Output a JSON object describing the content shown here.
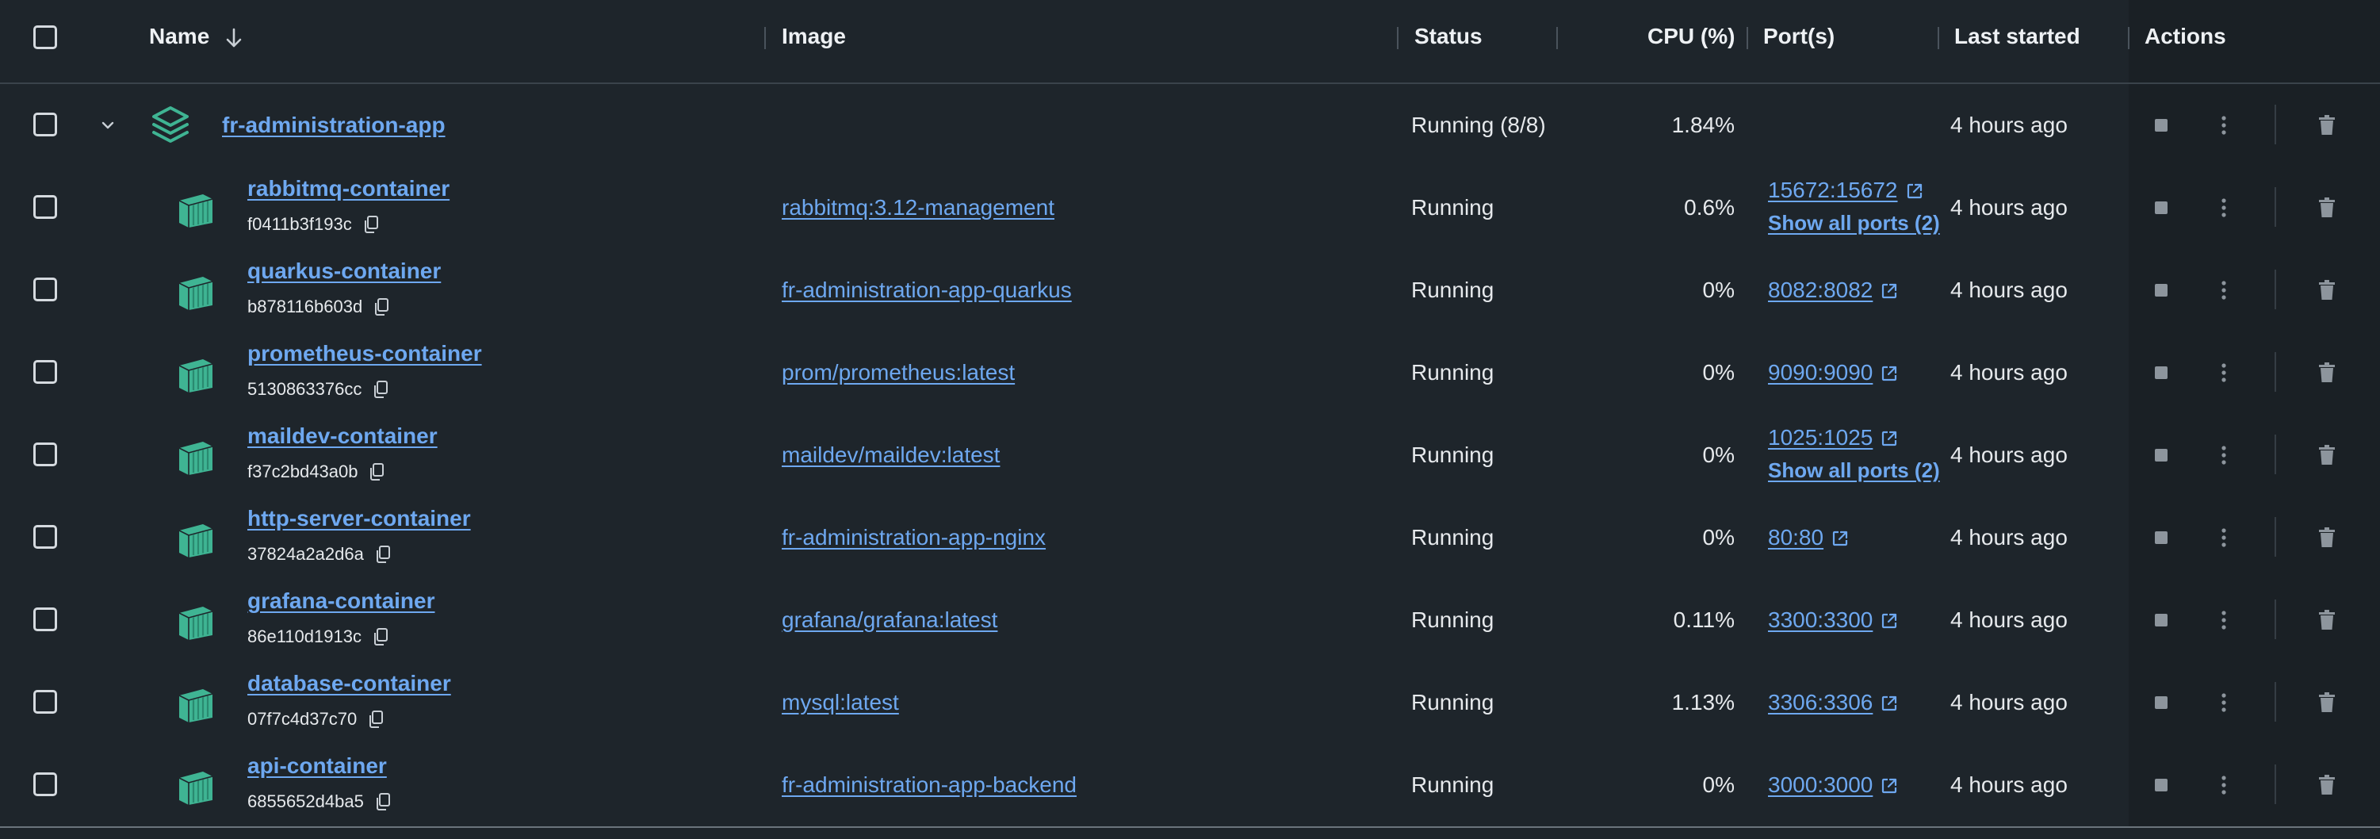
{
  "header": {
    "name": "Name",
    "image": "Image",
    "status": "Status",
    "cpu": "CPU (%)",
    "ports": "Port(s)",
    "last_started": "Last started",
    "actions": "Actions"
  },
  "group": {
    "name": "fr-administration-app",
    "status": "Running (8/8)",
    "cpu": "1.84%",
    "last_started": "4 hours ago"
  },
  "containers": [
    {
      "name": "rabbitmq-container",
      "id": "f0411b3f193c",
      "image": "rabbitmq:3.12-management",
      "status": "Running",
      "cpu": "0.6%",
      "port": "15672:15672",
      "show_all": "Show all ports (2)",
      "last_started": "4 hours ago"
    },
    {
      "name": "quarkus-container",
      "id": "b878116b603d",
      "image": "fr-administration-app-quarkus",
      "status": "Running",
      "cpu": "0%",
      "port": "8082:8082",
      "show_all": "",
      "last_started": "4 hours ago"
    },
    {
      "name": "prometheus-container",
      "id": "5130863376cc",
      "image": "prom/prometheus:latest",
      "status": "Running",
      "cpu": "0%",
      "port": "9090:9090",
      "show_all": "",
      "last_started": "4 hours ago"
    },
    {
      "name": "maildev-container",
      "id": "f37c2bd43a0b",
      "image": "maildev/maildev:latest",
      "status": "Running",
      "cpu": "0%",
      "port": "1025:1025",
      "show_all": "Show all ports (2)",
      "last_started": "4 hours ago"
    },
    {
      "name": "http-server-container",
      "id": "37824a2a2d6a",
      "image": "fr-administration-app-nginx",
      "status": "Running",
      "cpu": "0%",
      "port": "80:80",
      "show_all": "",
      "last_started": "4 hours ago"
    },
    {
      "name": "grafana-container",
      "id": "86e110d1913c",
      "image": "grafana/grafana:latest",
      "status": "Running",
      "cpu": "0.11%",
      "port": "3300:3300",
      "show_all": "",
      "last_started": "4 hours ago"
    },
    {
      "name": "database-container",
      "id": "07f7c4d37c70",
      "image": "mysql:latest",
      "status": "Running",
      "cpu": "1.13%",
      "port": "3306:3306",
      "show_all": "",
      "last_started": "4 hours ago"
    },
    {
      "name": "api-container",
      "id": "6855652d4ba5",
      "image": "fr-administration-app-backend",
      "status": "Running",
      "cpu": "0%",
      "port": "3000:3000",
      "show_all": "",
      "last_started": "4 hours ago"
    }
  ],
  "icons": {
    "sort": "arrow-down-icon",
    "expand": "chevron-down-icon",
    "group": "stack-layers-icon",
    "container": "cube-icon",
    "copy": "copy-icon",
    "external": "external-link-icon",
    "stop": "stop-icon",
    "more": "kebab-menu-icon",
    "delete": "trash-icon"
  },
  "colors": {
    "background": "#1e252b",
    "actions_bg": "#1a2025",
    "link": "#6ea8f0",
    "container_icon": "#3fb493"
  }
}
